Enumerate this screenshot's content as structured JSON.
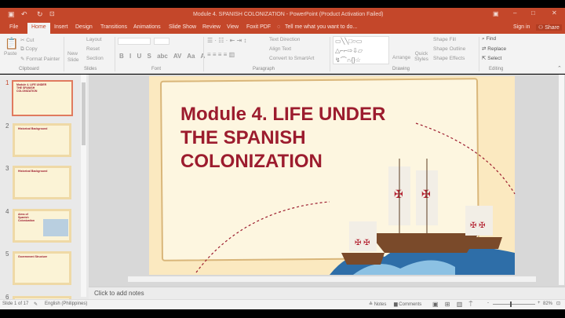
{
  "window": {
    "title": "Module 4. SPANISH COLONIZATION - PowerPoint (Product Activation Failed)"
  },
  "tabs": [
    {
      "label": "File"
    },
    {
      "label": "Home"
    },
    {
      "label": "Insert"
    },
    {
      "label": "Design"
    },
    {
      "label": "Transitions"
    },
    {
      "label": "Animations"
    },
    {
      "label": "Slide Show"
    },
    {
      "label": "Review"
    },
    {
      "label": "View"
    },
    {
      "label": "Foxit PDF"
    }
  ],
  "tell_me": "Tell me what you want to do...",
  "sign_in": "Sign in",
  "share": "Share",
  "ribbon": {
    "clipboard": {
      "label": "Clipboard",
      "paste": "Paste",
      "cut": "Cut",
      "copy": "Copy",
      "format_painter": "Format Painter"
    },
    "slides": {
      "label": "Slides",
      "new_slide": "New Slide",
      "layout": "Layout",
      "reset": "Reset",
      "section": "Section"
    },
    "font": {
      "label": "Font",
      "buttons": [
        "B",
        "I",
        "U",
        "S",
        "abc",
        "AV",
        "Aa",
        "A"
      ]
    },
    "paragraph": {
      "label": "Paragraph",
      "text_direction": "Text Direction",
      "align_text": "Align Text",
      "convert": "Convert to SmartArt"
    },
    "drawing": {
      "label": "Drawing",
      "arrange": "Arrange",
      "quick_styles": "Quick Styles",
      "shape_fill": "Shape Fill",
      "shape_outline": "Shape Outline",
      "shape_effects": "Shape Effects"
    },
    "editing": {
      "label": "Editing",
      "find": "Find",
      "replace": "Replace",
      "select": "Select"
    }
  },
  "thumbnails": [
    {
      "num": "1",
      "title": "Module 4. LIFE UNDER THE SPANISH COLONIZATION"
    },
    {
      "num": "2",
      "title": "Historical Background"
    },
    {
      "num": "3",
      "title": "Historical Background"
    },
    {
      "num": "4",
      "title": "Aims of Spanish Colonization"
    },
    {
      "num": "5",
      "title": "Government Structure"
    },
    {
      "num": "6",
      "title": ""
    }
  ],
  "slide": {
    "title": "Module 4. LIFE UNDER THE SPANISH COLONIZATION"
  },
  "notes_placeholder": "Click to add notes",
  "status": {
    "slide": "Slide 1 of 17",
    "language": "English (Philippines)",
    "notes": "Notes",
    "comments": "Comments",
    "zoom": "82%",
    "zoom_level": 82
  },
  "colors": {
    "accent": "#c4472a",
    "title": "#9c1c2e"
  }
}
